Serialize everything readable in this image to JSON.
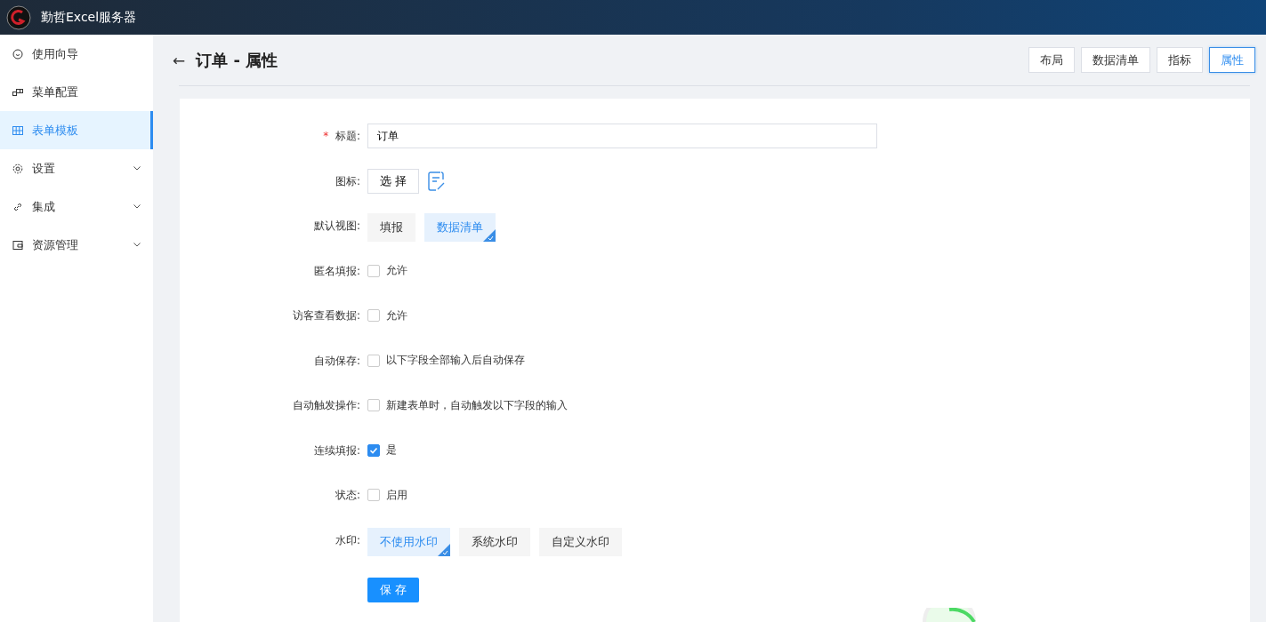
{
  "app": {
    "title": "勤哲Excel服务器"
  },
  "sidebar": {
    "items": [
      {
        "label": "使用向导",
        "selected": false,
        "has_submenu": false
      },
      {
        "label": "菜单配置",
        "selected": false,
        "has_submenu": false
      },
      {
        "label": "表单模板",
        "selected": true,
        "has_submenu": false
      },
      {
        "label": "设置",
        "selected": false,
        "has_submenu": true
      },
      {
        "label": "集成",
        "selected": false,
        "has_submenu": true
      },
      {
        "label": "资源管理",
        "selected": false,
        "has_submenu": true
      }
    ]
  },
  "header": {
    "back": "←",
    "title": "订单 - 属性",
    "tabs": [
      {
        "label": "布局",
        "selected": false
      },
      {
        "label": "数据清单",
        "selected": false
      },
      {
        "label": "指标",
        "selected": false
      },
      {
        "label": "属性",
        "selected": true
      }
    ]
  },
  "form": {
    "rows": [
      {
        "kind": "input",
        "label": "标题:",
        "required_mark": "*",
        "value": "订单"
      },
      {
        "kind": "icon",
        "label": "图标:",
        "button": "选 择"
      },
      {
        "kind": "options",
        "label": "默认视图:",
        "options": [
          {
            "label": "填报",
            "selected": false
          },
          {
            "label": "数据清单",
            "selected": true
          }
        ]
      },
      {
        "kind": "checkbox",
        "label": "匿名填报:",
        "text": "允许",
        "checked": false
      },
      {
        "kind": "checkbox",
        "label": "访客查看数据:",
        "text": "允许",
        "checked": false
      },
      {
        "kind": "checkbox",
        "label": "自动保存:",
        "text": "以下字段全部输入后自动保存",
        "checked": false
      },
      {
        "kind": "checkbox",
        "label": "自动触发操作:",
        "text": "新建表单时，自动触发以下字段的输入",
        "checked": false
      },
      {
        "kind": "checkbox",
        "label": "连续填报:",
        "text": "是",
        "checked": true
      },
      {
        "kind": "checkbox",
        "label": "状态:",
        "text": "启用",
        "checked": false
      },
      {
        "kind": "options",
        "label": "水印:",
        "options": [
          {
            "label": "不使用水印",
            "selected": true
          },
          {
            "label": "系统水印",
            "selected": false
          },
          {
            "label": "自定义水印",
            "selected": false
          }
        ]
      }
    ],
    "save": "保 存"
  }
}
